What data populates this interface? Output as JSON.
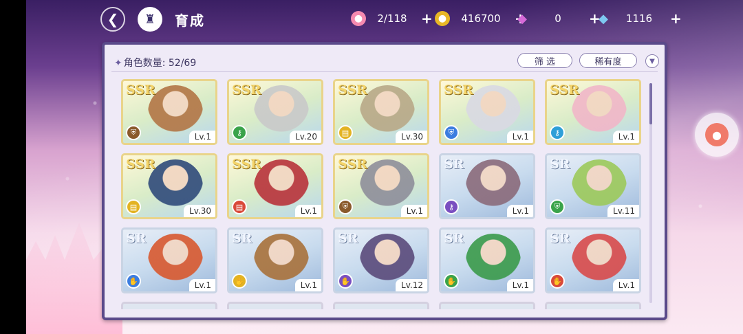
{
  "header": {
    "title": "育成",
    "resources": [
      {
        "icon": "candy-icon",
        "value": "2/118",
        "color": "#f58ab0"
      },
      {
        "icon": "gold-coin-icon",
        "value": "416700",
        "color": "#e8b726"
      },
      {
        "icon": "pink-diamond-icon",
        "value": "0",
        "color": "#d66ad8"
      },
      {
        "icon": "blue-diamond-icon",
        "value": "1116",
        "color": "#7ec8f0"
      }
    ],
    "plus_label": "+"
  },
  "panel": {
    "count_label": "角色数量: 52/69",
    "filter_label": "筛 选",
    "sort_label": "稀有度"
  },
  "cards": [
    {
      "rarity": "SSR",
      "level": "Lv.1",
      "element": "shield",
      "elem_color": "#8a5a2b",
      "tint": "#b27545"
    },
    {
      "rarity": "SSR",
      "level": "Lv.20",
      "element": "key",
      "elem_color": "#3aa34a",
      "tint": "#c9c9c9"
    },
    {
      "rarity": "SSR",
      "level": "Lv.30",
      "element": "book",
      "elem_color": "#e3b322",
      "tint": "#b8a887"
    },
    {
      "rarity": "SSR",
      "level": "Lv.1",
      "element": "shield",
      "elem_color": "#3c7de0",
      "tint": "#d9d9e3"
    },
    {
      "rarity": "SSR",
      "level": "Lv.1",
      "element": "key",
      "elem_color": "#2e9fd8",
      "tint": "#f1b6c8"
    },
    {
      "rarity": "SSR",
      "level": "Lv.30",
      "element": "book",
      "elem_color": "#e3b322",
      "tint": "#2f4a7a"
    },
    {
      "rarity": "SSR",
      "level": "Lv.1",
      "element": "book",
      "elem_color": "#d94a3a",
      "tint": "#b8323a"
    },
    {
      "rarity": "SSR",
      "level": "Lv.1",
      "element": "shield",
      "elem_color": "#8a5a2b",
      "tint": "#8e8e9a"
    },
    {
      "rarity": "SR",
      "level": "Lv.1",
      "element": "key",
      "elem_color": "#7a4ec0",
      "tint": "#8a6a7a"
    },
    {
      "rarity": "SR",
      "level": "Lv.11",
      "element": "shield",
      "elem_color": "#3aa34a",
      "tint": "#9cc95a"
    },
    {
      "rarity": "SR",
      "level": "Lv.1",
      "element": "hand",
      "elem_color": "#3c7de0",
      "tint": "#d8582e"
    },
    {
      "rarity": "SR",
      "level": "Lv.1",
      "element": "hand",
      "elem_color": "#e3b322",
      "tint": "#a8713a"
    },
    {
      "rarity": "SR",
      "level": "Lv.12",
      "element": "hand",
      "elem_color": "#7a4ec0",
      "tint": "#5a4a7a"
    },
    {
      "rarity": "SR",
      "level": "Lv.1",
      "element": "hand",
      "elem_color": "#3aa34a",
      "tint": "#3a9a4a"
    },
    {
      "rarity": "SR",
      "level": "Lv.1",
      "element": "hand",
      "elem_color": "#d94a3a",
      "tint": "#d84a4a"
    }
  ]
}
